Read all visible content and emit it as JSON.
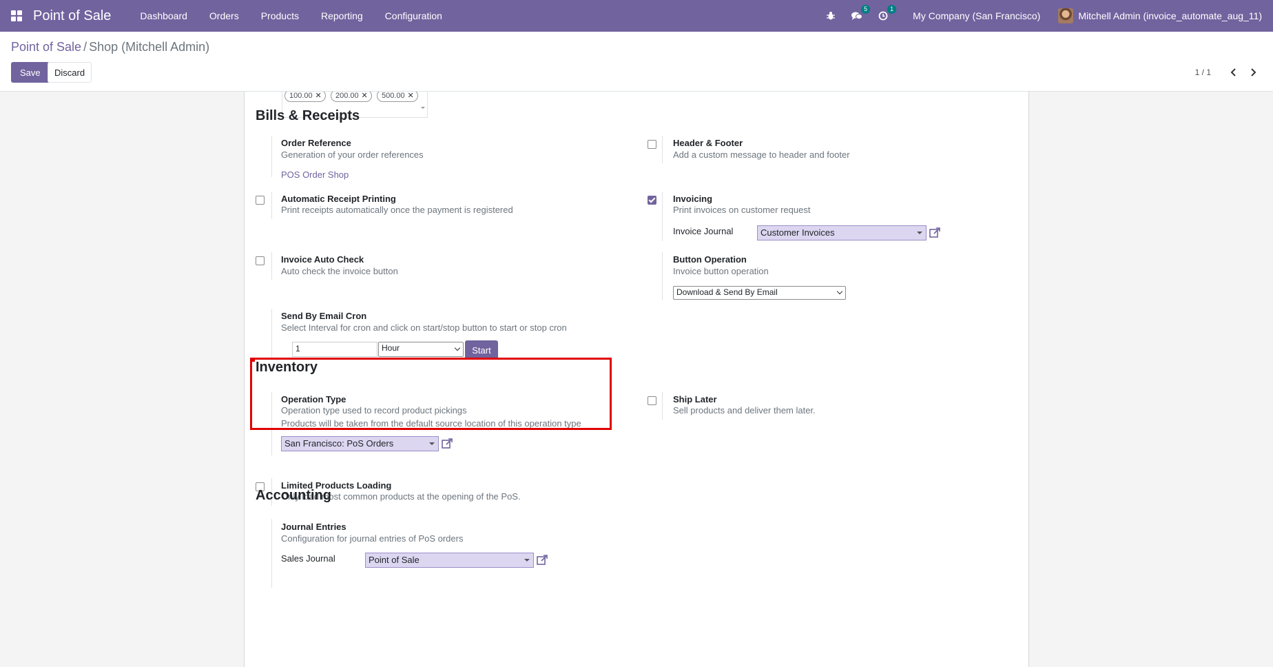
{
  "navbar": {
    "app_title": "Point of Sale",
    "menu": [
      "Dashboard",
      "Orders",
      "Products",
      "Reporting",
      "Configuration"
    ],
    "messages_count": "5",
    "activities_count": "1",
    "company": "My Company (San Francisco)",
    "user": "Mitchell Admin (invoice_automate_aug_11)"
  },
  "control_panel": {
    "breadcrumb_root": "Point of Sale",
    "breadcrumb_sep": "/",
    "breadcrumb_current": "Shop (Mitchell Admin)",
    "save_label": "Save",
    "discard_label": "Discard",
    "pager": "1 / 1"
  },
  "form": {
    "cash_tags": [
      "100.00",
      "200.00",
      "500.00"
    ],
    "bills_receipts": {
      "title": "Bills & Receipts",
      "order_reference": {
        "title": "Order Reference",
        "desc": "Generation of your order references",
        "link": "POS Order Shop"
      },
      "header_footer": {
        "title": "Header & Footer",
        "desc": "Add a custom message to header and footer",
        "checked": false
      },
      "auto_receipt": {
        "title": "Automatic Receipt Printing",
        "desc": "Print receipts automatically once the payment is registered",
        "checked": false
      },
      "invoicing": {
        "title": "Invoicing",
        "desc": "Print invoices on customer request",
        "checked": true,
        "journal_label": "Invoice Journal",
        "journal_value": "Customer Invoices"
      },
      "invoice_auto_check": {
        "title": "Invoice Auto Check",
        "desc": "Auto check the invoice button",
        "checked": false
      },
      "button_operation": {
        "title": "Button Operation",
        "desc": "Invoice button operation",
        "value": "Download & Send By Email"
      },
      "send_email_cron": {
        "title": "Send By Email Cron",
        "desc": "Select Interval for cron and click on start/stop button to start or stop cron",
        "interval_value": "1",
        "interval_unit": "Hour",
        "start_label": "Start"
      }
    },
    "inventory": {
      "title": "Inventory",
      "operation_type": {
        "title": "Operation Type",
        "desc1": "Operation type used to record product pickings",
        "desc2": "Products will be taken from the default source location of this operation type",
        "value": "San Francisco: PoS Orders"
      },
      "ship_later": {
        "title": "Ship Later",
        "desc": "Sell products and deliver them later.",
        "checked": false
      },
      "limited_products": {
        "title": "Limited Products Loading",
        "desc": "Only load most common products at the opening of the PoS.",
        "checked": false
      }
    },
    "accounting": {
      "title": "Accounting",
      "journal_entries": {
        "title": "Journal Entries",
        "desc": "Configuration for journal entries of PoS orders",
        "sales_journal_label": "Sales Journal",
        "sales_journal_value": "Point of Sale"
      }
    }
  },
  "colors": {
    "brand": "#71639e",
    "highlight": "#e00000",
    "badge": "#017e84"
  }
}
